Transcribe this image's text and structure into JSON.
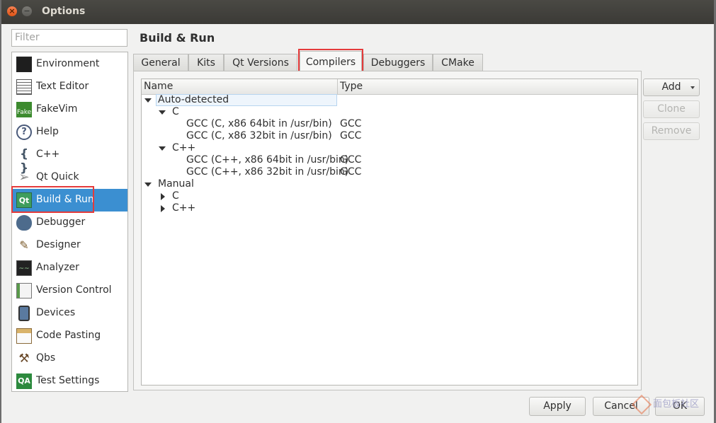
{
  "window": {
    "title": "Options"
  },
  "filter": {
    "placeholder": "Filter"
  },
  "sidebar": {
    "items": [
      {
        "label": "Environment",
        "icon": "monitor-icon"
      },
      {
        "label": "Text Editor",
        "icon": "text-editor-icon"
      },
      {
        "label": "FakeVim",
        "icon": "fakevim-icon",
        "badge": "Fake"
      },
      {
        "label": "Help",
        "icon": "help-icon"
      },
      {
        "label": "C++",
        "icon": "braces-icon"
      },
      {
        "label": "Qt Quick",
        "icon": "paper-plane-icon"
      },
      {
        "label": "Build & Run",
        "icon": "build-run-icon",
        "selected": true
      },
      {
        "label": "Debugger",
        "icon": "bug-icon"
      },
      {
        "label": "Designer",
        "icon": "designer-icon"
      },
      {
        "label": "Analyzer",
        "icon": "analyzer-icon"
      },
      {
        "label": "Version Control",
        "icon": "version-control-icon"
      },
      {
        "label": "Devices",
        "icon": "device-icon"
      },
      {
        "label": "Code Pasting",
        "icon": "clipboard-icon"
      },
      {
        "label": "Qbs",
        "icon": "hammer-icon"
      },
      {
        "label": "Test Settings",
        "icon": "qa-icon",
        "badge": "QA"
      }
    ]
  },
  "page": {
    "title": "Build & Run"
  },
  "tabs": [
    {
      "label": "General"
    },
    {
      "label": "Kits"
    },
    {
      "label": "Qt Versions"
    },
    {
      "label": "Compilers",
      "active": true
    },
    {
      "label": "Debuggers"
    },
    {
      "label": "CMake"
    }
  ],
  "table": {
    "columns": [
      "Name",
      "Type"
    ],
    "rows": [
      {
        "name": "Auto-detected",
        "type": "",
        "level": 0,
        "expanded": true,
        "selected": true
      },
      {
        "name": "C",
        "type": "",
        "level": 1,
        "expanded": true
      },
      {
        "name": "GCC (C, x86 64bit in /usr/bin)",
        "type": "GCC",
        "level": 2
      },
      {
        "name": "GCC (C, x86 32bit in /usr/bin)",
        "type": "GCC",
        "level": 2
      },
      {
        "name": "C++",
        "type": "",
        "level": 1,
        "expanded": true
      },
      {
        "name": "GCC (C++, x86 64bit in /usr/bin)",
        "type": "GCC",
        "level": 2
      },
      {
        "name": "GCC (C++, x86 32bit in /usr/bin)",
        "type": "GCC",
        "level": 2
      },
      {
        "name": "Manual",
        "type": "",
        "level": 0,
        "expanded": true
      },
      {
        "name": "C",
        "type": "",
        "level": 1,
        "expanded": false
      },
      {
        "name": "C++",
        "type": "",
        "level": 1,
        "expanded": false
      }
    ]
  },
  "actions": {
    "add": "Add",
    "clone": "Clone",
    "remove": "Remove"
  },
  "footer": {
    "apply": "Apply",
    "cancel": "Cancel",
    "ok": "OK"
  },
  "watermark": {
    "text": "面包板社区"
  },
  "colors": {
    "selection": "#3b8fd1",
    "highlight_box": "#e43b3b"
  }
}
